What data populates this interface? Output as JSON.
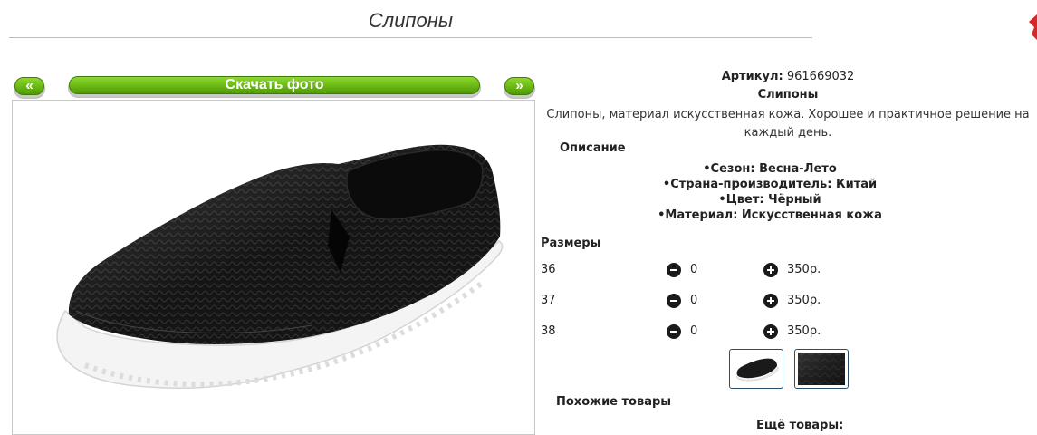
{
  "page": {
    "title": "Слипоны"
  },
  "nav": {
    "prev_label": "«",
    "next_label": "»",
    "download_label": "Скачать фото"
  },
  "product": {
    "sku_label": "Артикул:",
    "sku": "961669032",
    "name": "Слипоны",
    "description": "Слипоны, материал искусственная кожа. Хорошее и практичное решение на каждый день.",
    "description_heading": "Описание",
    "specs": [
      "Сезон: Весна-Лето",
      "Страна-производитель: Китай",
      "Цвет: Чёрный",
      "Материал: Искусственная кожа"
    ]
  },
  "sizes": {
    "heading": "Размеры",
    "rows": [
      {
        "size": "36",
        "qty": "0",
        "price": "350р."
      },
      {
        "size": "37",
        "qty": "0",
        "price": "350р."
      },
      {
        "size": "38",
        "qty": "0",
        "price": "350р."
      }
    ]
  },
  "related": {
    "similar_heading": "Похожие товары",
    "more_heading": "Ещё товары:"
  },
  "colors": {
    "accent_green": "#6dbb16",
    "thumb_border": "#2a4d6e",
    "corner_red": "#d62828"
  },
  "icons": {
    "minus": "minus-circle-icon",
    "plus": "plus-circle-icon"
  }
}
